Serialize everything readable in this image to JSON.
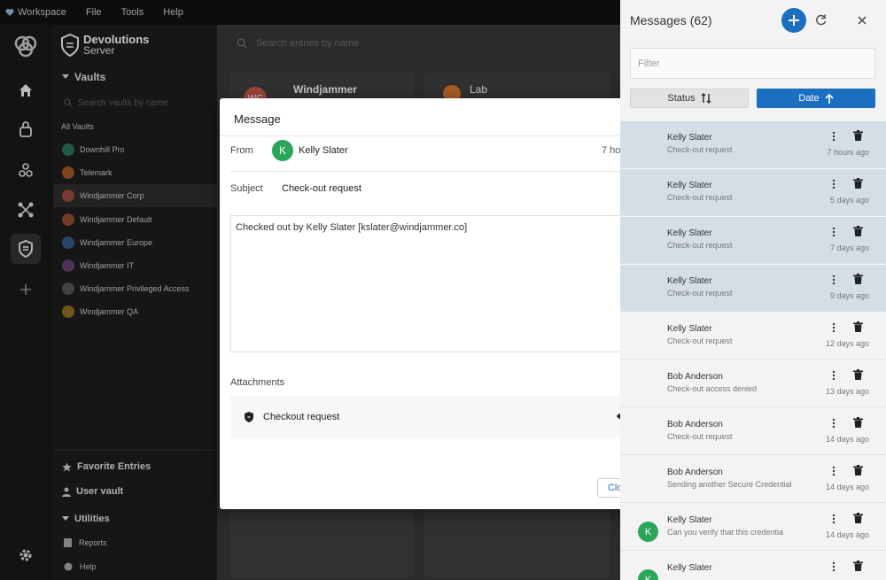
{
  "app": {
    "menu": [
      "Workspace",
      "File",
      "Tools",
      "Help"
    ],
    "brand_line1": "Devolutions",
    "brand_line2": "Server"
  },
  "nav": {
    "vaults_heading": "Vaults",
    "vault_search_placeholder": "Search vaults by name",
    "all_vaults": "All Vaults",
    "vaults": [
      {
        "label": "Downhill Pro",
        "color": "#2f8f6b"
      },
      {
        "label": "Telemark",
        "color": "#c76b2a"
      },
      {
        "label": "Windjammer Corp",
        "color": "#b85040"
      },
      {
        "label": "Windjammer Default",
        "color": "#b8583a"
      },
      {
        "label": "Windjammer Europe",
        "color": "#3f6aa8"
      },
      {
        "label": "Windjammer IT",
        "color": "#7a4a8a"
      },
      {
        "label": "Windjammer Privileged Access",
        "color": "#666666"
      },
      {
        "label": "Windjammer QA",
        "color": "#b5862b"
      }
    ],
    "favorite_entries": "Favorite Entries",
    "user_vault": "User vault",
    "utilities": "Utilities",
    "reports": "Reports",
    "help": "Help"
  },
  "content": {
    "search_placeholder": "Search entries by name",
    "card1_title": "Windjammer",
    "card1_initials": "WC",
    "card2_title": "Lab"
  },
  "modal": {
    "title": "Message",
    "from_label": "From",
    "from_name": "Kelly Slater",
    "from_initial": "K",
    "time": "7 hours ago",
    "subject_label": "Subject",
    "subject": "Check-out request",
    "body": "Checked out by Kelly Slater [kslater@windjammer.co]",
    "attachments_label": "Attachments",
    "attachment_name": "Checkout request",
    "close_label": "Close"
  },
  "panel": {
    "title": "Messages (62)",
    "filter_placeholder": "Filter",
    "status_label": "Status",
    "date_label": "Date",
    "accent": "#1c6fc0",
    "messages": [
      {
        "name": "Kelly Slater",
        "subject": "Check-out request",
        "time": "7 hours ago",
        "initial": "",
        "highlight": true
      },
      {
        "name": "Kelly Slater",
        "subject": "Check-out request",
        "time": "5 days ago",
        "initial": "",
        "highlight": true
      },
      {
        "name": "Kelly Slater",
        "subject": "Check-out request",
        "time": "7 days ago",
        "initial": "",
        "highlight": true
      },
      {
        "name": "Kelly Slater",
        "subject": "Check-out request",
        "time": "9 days ago",
        "initial": "",
        "highlight": true
      },
      {
        "name": "Kelly Slater",
        "subject": "Check-out request",
        "time": "12 days ago",
        "initial": "",
        "highlight": false
      },
      {
        "name": "Bob Anderson",
        "subject": "Check-out access denied",
        "time": "13 days ago",
        "initial": "",
        "highlight": false
      },
      {
        "name": "Bob Anderson",
        "subject": "Check-out request",
        "time": "14 days ago",
        "initial": "",
        "highlight": false
      },
      {
        "name": "Bob Anderson",
        "subject": "Sending another Secure Credential",
        "time": "14 days ago",
        "initial": "",
        "highlight": false
      },
      {
        "name": "Kelly Slater",
        "subject": "Can you verify that this credentia",
        "time": "14 days ago",
        "initial": "K",
        "highlight": false
      },
      {
        "name": "Kelly Slater",
        "subject": "",
        "time": "",
        "initial": "K",
        "highlight": false
      }
    ]
  }
}
